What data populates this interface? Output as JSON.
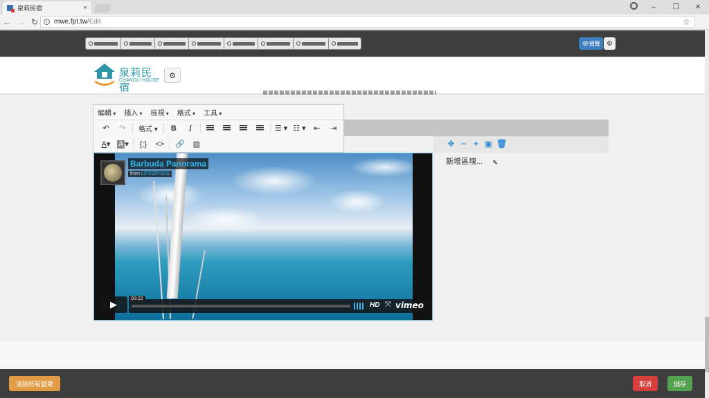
{
  "browser": {
    "tab_title": "泉莉民宿",
    "tab_close": "×",
    "url_host": "mwe.fpt.tw",
    "url_path": "/Edit",
    "window_controls": [
      "–",
      "❐",
      "✕"
    ]
  },
  "admin_bar": {
    "preview_label": "預覽",
    "tools_count": 8
  },
  "header": {
    "logo_title": "泉莉民宿",
    "logo_subtitle": "CHANGLI HOUSE"
  },
  "editor": {
    "menus": [
      "編輯",
      "插入",
      "檢視",
      "格式",
      "工具"
    ],
    "format_select": "格式",
    "code_btn": "{;}",
    "source_btn": "<>"
  },
  "side_panel": {
    "add_block": "新增區塊..."
  },
  "video": {
    "title": "Barbuda Panorama",
    "from_prefix": "from",
    "from_author": "LIFEOFVIDS",
    "time": "00:22",
    "hd": "HD",
    "brand": "vimeo"
  },
  "footer": {
    "clear_label": "清除所有變更",
    "cancel_label": "取消",
    "save_label": "儲存"
  },
  "colors": {
    "accent": "#3e7fc1",
    "logo": "#2e96a8",
    "clear": "#e39b46",
    "cancel": "#d6403d",
    "save": "#54a14f",
    "dark_bar": "#3e3e3e"
  }
}
